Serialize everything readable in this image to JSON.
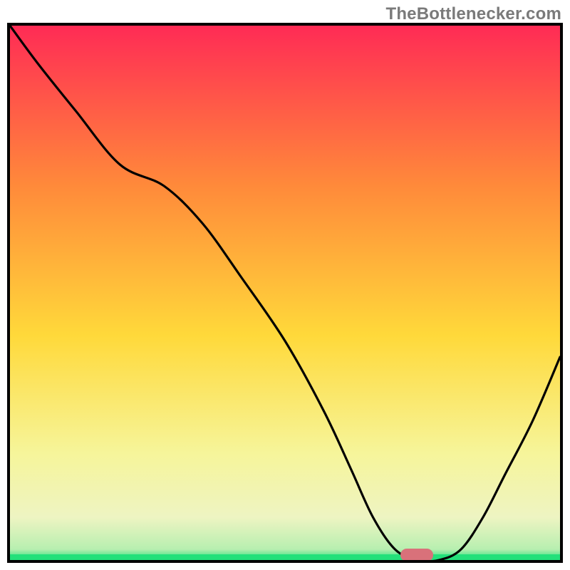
{
  "watermark": "TheBottlenecker.com",
  "colors": {
    "top": "#ff2b55",
    "mid_upper": "#ff8a3a",
    "mid": "#ffd93a",
    "mid_lower": "#f6f59a",
    "band_pale": "#f2f7c7",
    "bottom": "#23e07a",
    "pill": "#d9717a",
    "axis": "#000000"
  },
  "chart_data": {
    "type": "line",
    "title": "",
    "xlabel": "",
    "ylabel": "",
    "xlim": [
      0,
      100
    ],
    "ylim": [
      0,
      100
    ],
    "series": [
      {
        "name": "bottleneck-curve",
        "x": [
          0,
          5,
          12,
          20,
          28,
          35,
          42,
          50,
          57,
          62,
          66,
          70,
          74,
          78,
          82,
          86,
          90,
          95,
          100
        ],
        "y": [
          100,
          93,
          84,
          74,
          70,
          63,
          53,
          41,
          28,
          17,
          8,
          2,
          0,
          0,
          2,
          8,
          16,
          26,
          38
        ]
      }
    ],
    "marker": {
      "name": "optimal-region",
      "x_center": 74,
      "y": 0,
      "width_pct": 6
    },
    "gradient_stops": [
      {
        "pct": 0,
        "color": "#ff2b55"
      },
      {
        "pct": 30,
        "color": "#ff8a3a"
      },
      {
        "pct": 58,
        "color": "#ffd93a"
      },
      {
        "pct": 80,
        "color": "#f6f59a"
      },
      {
        "pct": 92,
        "color": "#eef4c2"
      },
      {
        "pct": 98,
        "color": "#b7efb0"
      },
      {
        "pct": 100,
        "color": "#23e07a"
      }
    ]
  }
}
